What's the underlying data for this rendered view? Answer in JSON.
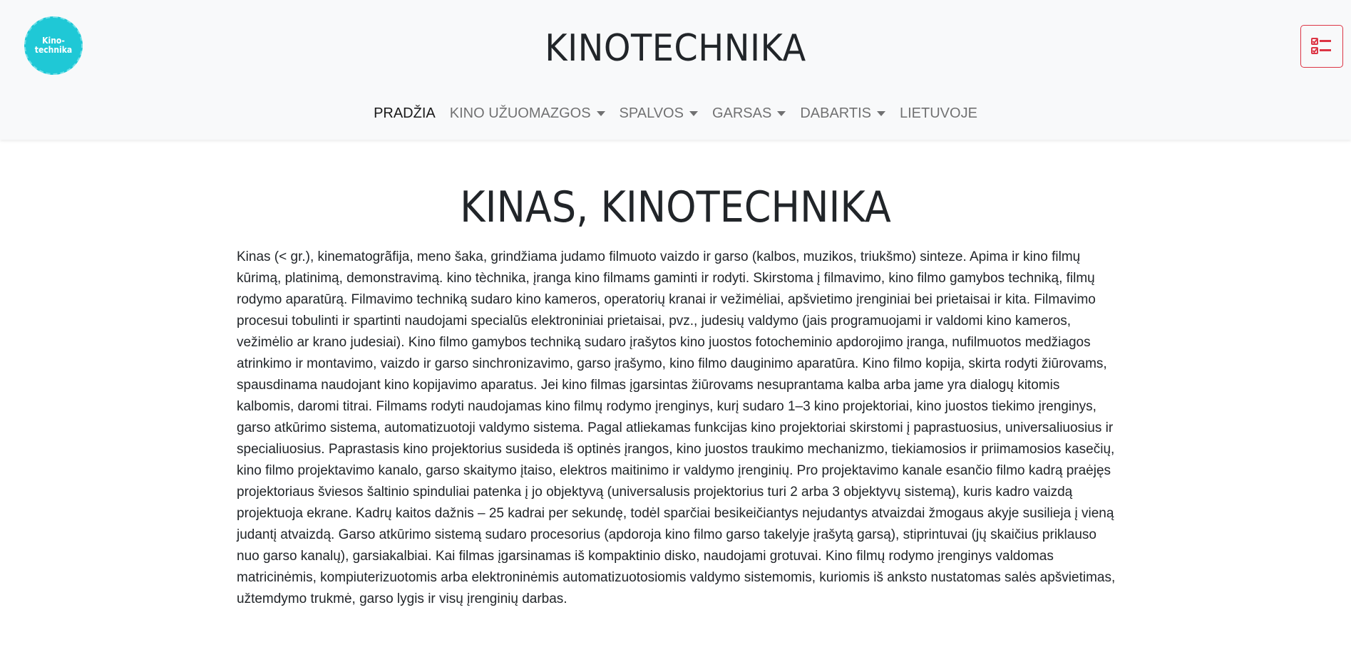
{
  "header": {
    "logo_text": "Kino-\ntechnika",
    "site_title": "KINOTECHNIKA",
    "tasks_icon": "checklist-icon",
    "accent_color": "#dc3545",
    "logo_color": "#1fc8d6"
  },
  "nav": {
    "items": [
      {
        "label": "PRADŽIA",
        "active": true,
        "dropdown": false
      },
      {
        "label": "KINO UŽUOMAZGOS",
        "active": false,
        "dropdown": true
      },
      {
        "label": "SPALVOS",
        "active": false,
        "dropdown": true
      },
      {
        "label": "GARSAS",
        "active": false,
        "dropdown": true
      },
      {
        "label": "DABARTIS",
        "active": false,
        "dropdown": true
      },
      {
        "label": "LIETUVOJE",
        "active": false,
        "dropdown": false
      }
    ]
  },
  "main": {
    "title": "KINAS, KINOTECHNIKA",
    "paragraph": "Kinas (< gr.), kinematogrãfija, meno šaka, grindžiama judamo filmuoto vaizdo ir garso (kalbos, muzikos, triukšmo) sinteze. Apima ir kino filmų kūrimą, platinimą, demonstravimą. kino tèchnika, įranga kino filmams gaminti ir rodyti. Skirstoma į filmavimo, kino filmo gamybos techniką, filmų rodymo aparatūrą. Filmavimo techniką sudaro kino kameros, operatorių kranai ir vežimėliai, apšvietimo įrenginiai bei prietaisai ir kita. Filmavimo procesui tobulinti ir spartinti naudojami specialūs elektroniniai prietaisai, pvz., judesių valdymo (jais programuojami ir valdomi kino kameros, vežimėlio ar krano judesiai). Kino filmo gamybos techniką sudaro įrašytos kino juostos fotocheminio apdorojimo įranga, nufilmuotos medžiagos atrinkimo ir montavimo, vaizdo ir garso sinchronizavimo, garso įrašymo, kino filmo dauginimo aparatūra. Kino filmo kopija, skirta rodyti žiūrovams, spausdinama naudojant kino kopijavimo aparatus. Jei kino filmas įgarsintas žiūrovams nesuprantama kalba arba jame yra dialogų kitomis kalbomis, daromi titrai. Filmams rodyti naudojamas kino filmų rodymo įrenginys, kurį sudaro 1–3 kino projektoriai, kino juostos tiekimo įrenginys, garso atkūrimo sistema, automatizuotoji valdymo sistema. Pagal atliekamas funkcijas kino projektoriai skirstomi į paprastuosius, universaliuosius ir specialiuosius. Paprastasis kino projektorius susideda iš optinės įrangos, kino juostos traukimo mechanizmo, tiekiamosios ir priimamosios kasečių, kino filmo projektavimo kanalo, garso skaitymo įtaiso, elektros maitinimo ir valdymo įrenginių. Pro projektavimo kanale esančio filmo kadrą praėjęs projektoriaus šviesos šaltinio spinduliai patenka į jo objektyvą (universalusis projektorius turi 2 arba 3 objektyvų sistemą), kuris kadro vaizdą projektuoja ekrane. Kadrų kaitos dažnis – 25 kadrai per sekundę, todėl sparčiai besikeičiantys nejudantys atvaizdai žmogaus akyje susilieja į vieną judantį atvaizdą. Garso atkūrimo sistemą sudaro procesorius (apdoroja kino filmo garso takelyje įrašytą garsą), stiprintuvai (jų skaičius priklauso nuo garso kanalų), garsiakalbiai. Kai filmas įgarsinamas iš kompaktinio disko, naudojami grotuvai. Kino filmų rodymo įrenginys valdomas matricinėmis, kompiuterizuotomis arba elektroninėmis automatizuotosiomis valdymo sistemomis, kuriomis iš anksto nustatomas salės apšvietimas, užtemdymo trukmė, garso lygis ir visų įrenginių darbas."
  }
}
